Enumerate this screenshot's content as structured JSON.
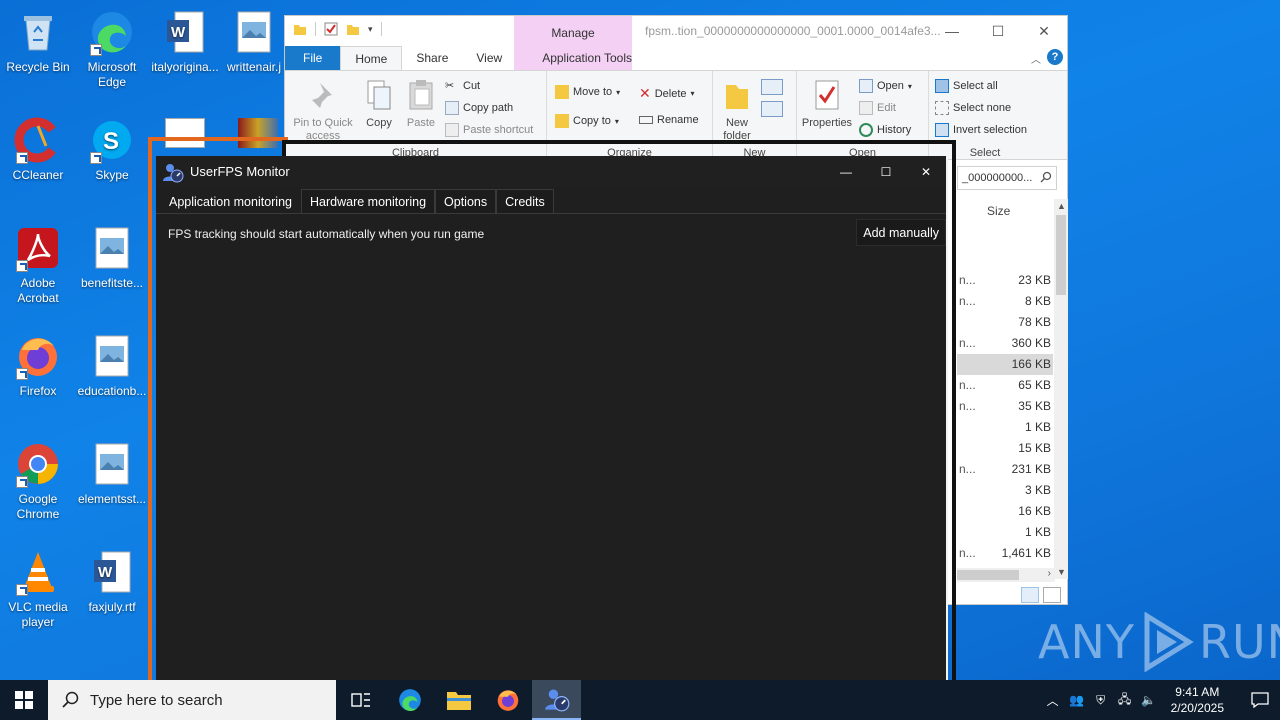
{
  "desktop": {
    "icons": [
      {
        "label": "Recycle Bin",
        "icon": "recycle-bin-icon"
      },
      {
        "label": "Microsoft Edge",
        "icon": "edge-icon"
      },
      {
        "label": "italyorigina...",
        "icon": "word-doc-icon"
      },
      {
        "label": "writtenair.j",
        "icon": "image-file-icon"
      },
      {
        "label": "CCleaner",
        "icon": "ccleaner-icon"
      },
      {
        "label": "Skype",
        "icon": "skype-icon"
      },
      {
        "label": "Adobe Acrobat",
        "icon": "acrobat-icon"
      },
      {
        "label": "benefitste...",
        "icon": "image-file-icon"
      },
      {
        "label": "Firefox",
        "icon": "firefox-icon"
      },
      {
        "label": "educationb...",
        "icon": "image-file-icon"
      },
      {
        "label": "Google Chrome",
        "icon": "chrome-icon"
      },
      {
        "label": "elementsst...",
        "icon": "image-file-icon"
      },
      {
        "label": "VLC media player",
        "icon": "vlc-icon"
      },
      {
        "label": "faxjuly.rtf",
        "icon": "word-doc-icon"
      }
    ]
  },
  "explorer": {
    "title": "fpsm..tion_0000000000000000_0001.0000_0014afe3...",
    "manage_label": "Manage",
    "tabs": {
      "file": "File",
      "home": "Home",
      "share": "Share",
      "view": "View",
      "app_tools": "Application Tools"
    },
    "clipboard": {
      "pin": "Pin to Quick access",
      "copy": "Copy",
      "paste": "Paste",
      "cut": "Cut",
      "copy_path": "Copy path",
      "paste_shortcut": "Paste shortcut",
      "label": "Clipboard"
    },
    "organize": {
      "move_to": "Move to",
      "copy_to": "Copy to",
      "delete": "Delete",
      "rename": "Rename",
      "label": "Organize"
    },
    "new": {
      "new_folder": "New folder",
      "label": "New"
    },
    "open": {
      "properties": "Properties",
      "open": "Open",
      "edit": "Edit",
      "history": "History",
      "label": "Open"
    },
    "select": {
      "select_all": "Select all",
      "select_none": "Select none",
      "invert": "Invert selection",
      "label": "Select"
    },
    "address_fragment": "_000000000...",
    "size_header": "Size",
    "rows": [
      {
        "name": "n...",
        "size": "23 KB"
      },
      {
        "name": "n...",
        "size": "8 KB"
      },
      {
        "name": "",
        "size": "78 KB"
      },
      {
        "name": "n...",
        "size": "360 KB"
      },
      {
        "name": "",
        "size": "166 KB"
      },
      {
        "name": "n...",
        "size": "65 KB"
      },
      {
        "name": "n...",
        "size": "35 KB"
      },
      {
        "name": "",
        "size": "1 KB"
      },
      {
        "name": "",
        "size": "15 KB"
      },
      {
        "name": "n...",
        "size": "231 KB"
      },
      {
        "name": "",
        "size": "3 KB"
      },
      {
        "name": "",
        "size": "16 KB"
      },
      {
        "name": "",
        "size": "1 KB"
      },
      {
        "name": "n...",
        "size": "1,461 KB"
      }
    ]
  },
  "fps_monitor": {
    "title": "UserFPS Monitor",
    "tabs": [
      "Application monitoring",
      "Hardware monitoring",
      "Options",
      "Credits"
    ],
    "message": "FPS tracking should start automatically when you run game",
    "add_button": "Add manually"
  },
  "watermark": {
    "left": "ANY",
    "right": "RUN"
  },
  "taskbar": {
    "search_placeholder": "Type here to search",
    "time": "9:41 AM",
    "date": "2/20/2025"
  }
}
